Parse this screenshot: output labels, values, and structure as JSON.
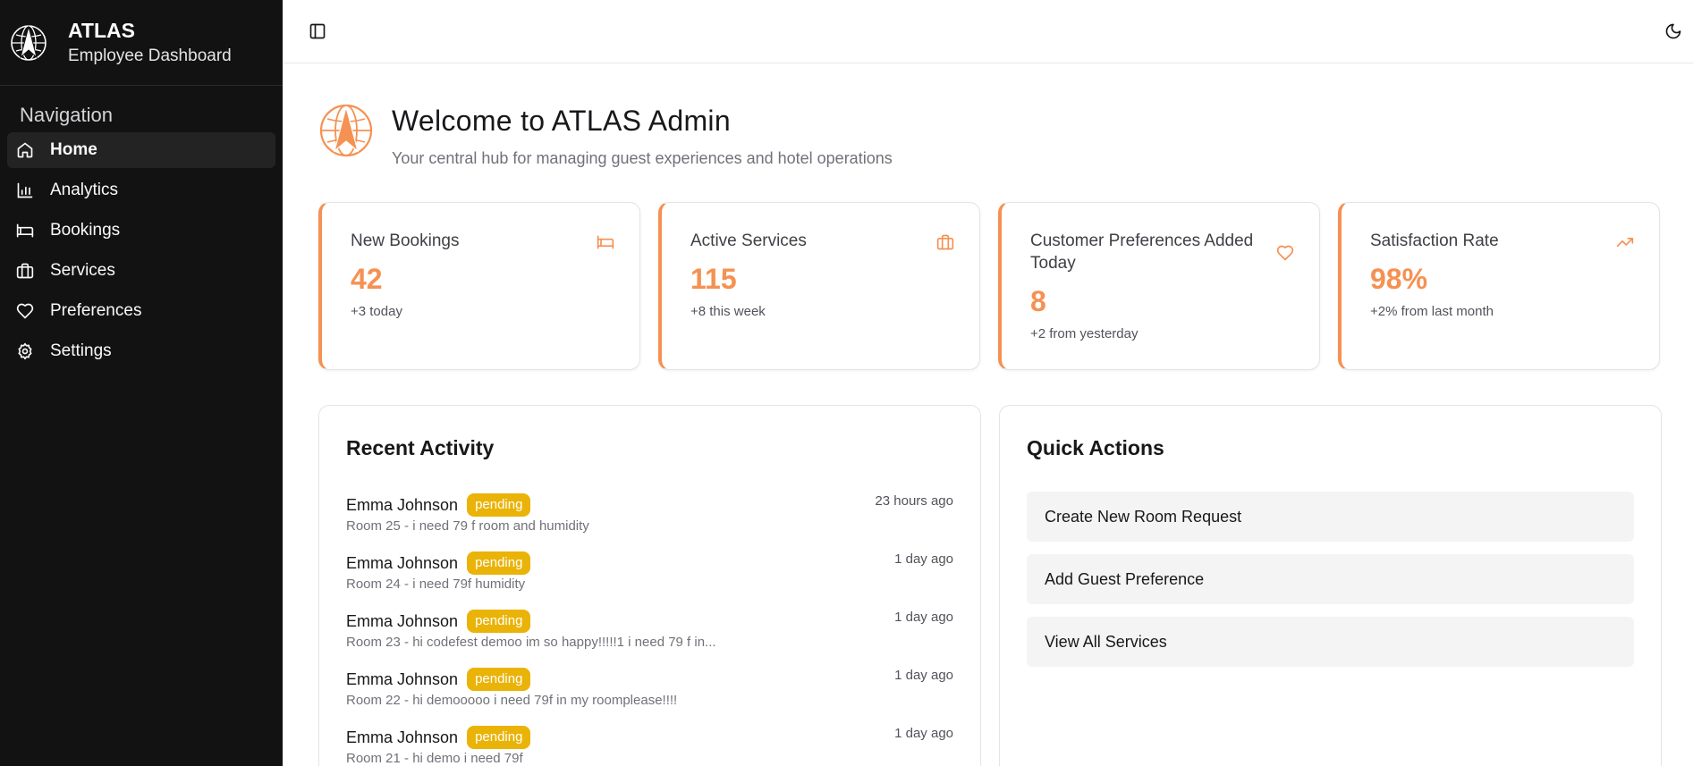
{
  "brand": {
    "title": "ATLAS",
    "subtitle": "Employee Dashboard"
  },
  "nav": {
    "heading": "Navigation",
    "items": [
      {
        "label": "Home",
        "icon": "home-icon",
        "active": true
      },
      {
        "label": "Analytics",
        "icon": "bar-chart-icon"
      },
      {
        "label": "Bookings",
        "icon": "bed-icon"
      },
      {
        "label": "Services",
        "icon": "briefcase-icon"
      },
      {
        "label": "Preferences",
        "icon": "heart-icon"
      },
      {
        "label": "Settings",
        "icon": "gear-icon"
      }
    ]
  },
  "topbar": {
    "toggle_icon": "sidebar-toggle-icon",
    "theme_icon": "moon-icon"
  },
  "welcome": {
    "title": "Welcome to ATLAS Admin",
    "subtitle": "Your central hub for managing guest experiences and hotel operations"
  },
  "stats": [
    {
      "label": "New Bookings",
      "value": "42",
      "note": "+3 today",
      "icon": "bed-icon"
    },
    {
      "label": "Active Services",
      "value": "115",
      "note": "+8 this week",
      "icon": "briefcase-icon"
    },
    {
      "label": "Customer Preferences Added Today",
      "value": "8",
      "note": "+2 from yesterday",
      "icon": "heart-icon"
    },
    {
      "label": "Satisfaction Rate",
      "value": "98%",
      "note": "+2% from last month",
      "icon": "trending-up-icon"
    }
  ],
  "recent_activity": {
    "title": "Recent Activity",
    "items": [
      {
        "name": "Emma Johnson",
        "status": "pending",
        "desc": "Room 25 - i need 79 f room and humidity",
        "time": "23 hours ago"
      },
      {
        "name": "Emma Johnson",
        "status": "pending",
        "desc": "Room 24 - i need 79f humidity",
        "time": "1 day ago"
      },
      {
        "name": "Emma Johnson",
        "status": "pending",
        "desc": "Room 23 - hi codefest demoo im so happy!!!!!1 i need 79 f in...",
        "time": "1 day ago"
      },
      {
        "name": "Emma Johnson",
        "status": "pending",
        "desc": "Room 22 - hi demooooo i need 79f in my roomplease!!!!",
        "time": "1 day ago"
      },
      {
        "name": "Emma Johnson",
        "status": "pending",
        "desc": "Room 21 - hi demo i need 79f",
        "time": "1 day ago"
      }
    ]
  },
  "quick_actions": {
    "title": "Quick Actions",
    "items": [
      {
        "label": "Create New Room Request"
      },
      {
        "label": "Add Guest Preference"
      },
      {
        "label": "View All Services"
      }
    ]
  },
  "colors": {
    "accent": "#f59152",
    "sidebar_bg": "#121212",
    "badge": "#eab308"
  }
}
